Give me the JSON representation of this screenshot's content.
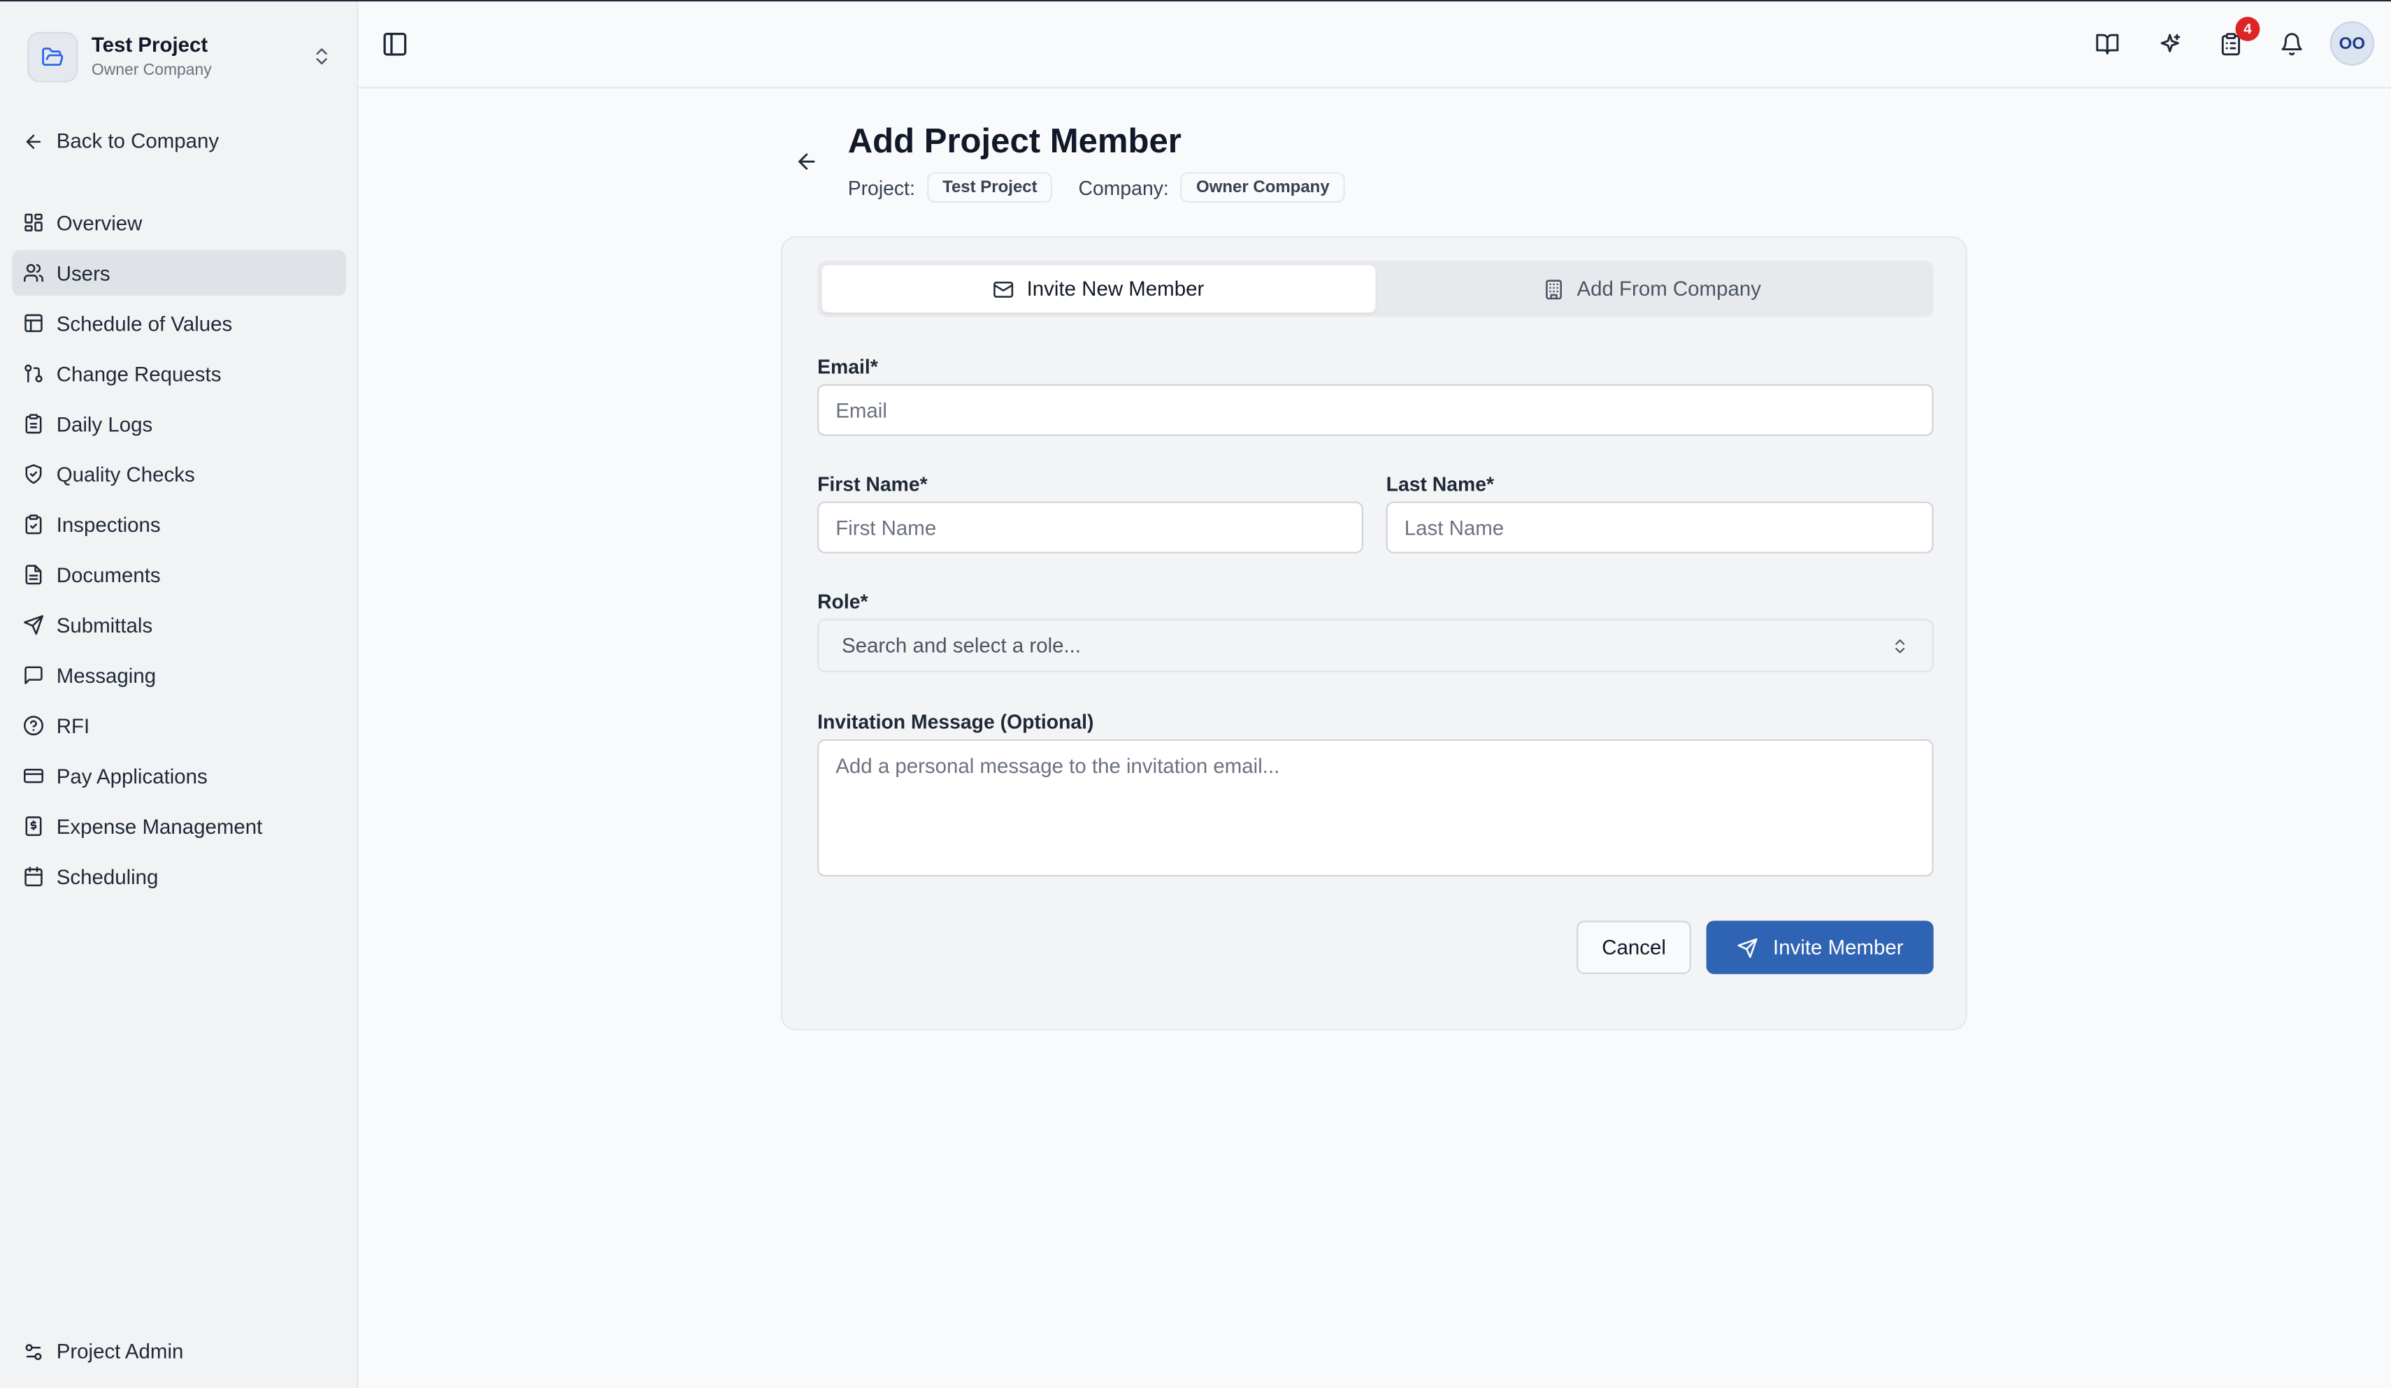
{
  "sidebar": {
    "project_name": "Test Project",
    "company_name": "Owner Company",
    "back_label": "Back to Company",
    "items": [
      {
        "label": "Overview",
        "icon": "layout-grid-icon"
      },
      {
        "label": "Users",
        "icon": "users-icon",
        "active": true
      },
      {
        "label": "Schedule of Values",
        "icon": "table-icon"
      },
      {
        "label": "Change Requests",
        "icon": "git-pull-request-icon"
      },
      {
        "label": "Daily Logs",
        "icon": "clipboard-icon"
      },
      {
        "label": "Quality Checks",
        "icon": "shield-check-icon"
      },
      {
        "label": "Inspections",
        "icon": "clipboard-check-icon"
      },
      {
        "label": "Documents",
        "icon": "file-text-icon"
      },
      {
        "label": "Submittals",
        "icon": "send-icon"
      },
      {
        "label": "Messaging",
        "icon": "message-square-icon"
      },
      {
        "label": "RFI",
        "icon": "help-circle-icon"
      },
      {
        "label": "Pay Applications",
        "icon": "credit-card-icon"
      },
      {
        "label": "Expense Management",
        "icon": "receipt-icon"
      },
      {
        "label": "Scheduling",
        "icon": "calendar-icon"
      }
    ],
    "admin_label": "Project Admin"
  },
  "topbar": {
    "tasks_badge": "4",
    "avatar_initials": "OO"
  },
  "page": {
    "title": "Add Project Member",
    "project_label": "Project:",
    "project_value": "Test Project",
    "company_label": "Company:",
    "company_value": "Owner Company"
  },
  "tabs": {
    "invite_new": "Invite New Member",
    "add_from_company": "Add From Company"
  },
  "form": {
    "email_label": "Email*",
    "email_placeholder": "Email",
    "first_name_label": "First Name*",
    "first_name_placeholder": "First Name",
    "last_name_label": "Last Name*",
    "last_name_placeholder": "Last Name",
    "role_label": "Role*",
    "role_placeholder": "Search and select a role...",
    "message_label": "Invitation Message (Optional)",
    "message_placeholder": "Add a personal message to the invitation email...",
    "cancel_label": "Cancel",
    "invite_label": "Invite Member"
  },
  "colors": {
    "primary": "#2f63b3",
    "badge": "#dc2626",
    "sidebar_bg": "#f1f3f5",
    "active_item_bg": "#dfe3e8"
  }
}
